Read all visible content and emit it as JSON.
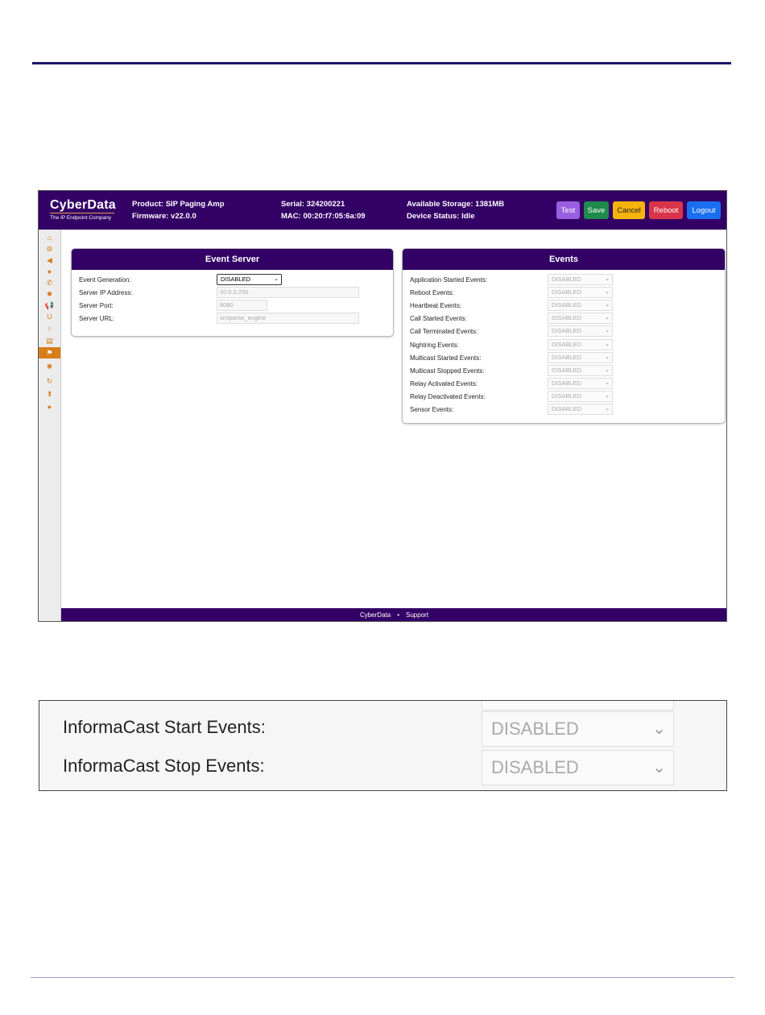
{
  "header": {
    "logo_name": "CyberData",
    "logo_tagline": "The IP Endpoint Company",
    "product": "Product: SIP Paging Amp",
    "firmware": "Firmware: v22.0.0",
    "serial": "Serial: 324200221",
    "mac": "MAC: 00:20:f7:05:6a:09",
    "storage": "Available Storage: 1381MB",
    "status": "Device Status: Idle",
    "buttons": {
      "test": "Test",
      "save": "Save",
      "cancel": "Cancel",
      "reboot": "Reboot",
      "logout": "Logout"
    }
  },
  "sidebar": {
    "icons": [
      "home-icon",
      "gears-icon",
      "speaker-icon",
      "globe-icon",
      "phone-icon",
      "gear-icon",
      "megaphone-icon",
      "magnet-icon",
      "bulb-icon",
      "document-icon",
      "flag-icon",
      "sun-icon",
      "sync-icon",
      "upload-icon",
      "user-icon"
    ],
    "glyphs": [
      "⌂",
      "⚙",
      "◀",
      "●",
      "✆",
      "✹",
      "📢",
      "U",
      "♀",
      "▤",
      "⚑",
      "✺",
      "↻",
      "⬆",
      "●"
    ],
    "active_index": 10
  },
  "event_server": {
    "title": "Event Server",
    "generation_label": "Event Generation:",
    "generation_value": "DISABLED",
    "ip_label": "Server IP Address:",
    "ip_value": "10.0.0.250",
    "port_label": "Server Port:",
    "port_value": "8080",
    "url_label": "Server URL:",
    "url_value": "xmlparse_engine"
  },
  "events": {
    "title": "Events",
    "rows": [
      {
        "label": "Application Started Events:",
        "value": "DISABLED"
      },
      {
        "label": "Reboot Events:",
        "value": "DISABLED"
      },
      {
        "label": "Heartbeat Events:",
        "value": "DISABLED"
      },
      {
        "label": "Call Started Events:",
        "value": "DISABLED"
      },
      {
        "label": "Call Terminated Events:",
        "value": "DISABLED"
      },
      {
        "label": "Nightring Events:",
        "value": "DISABLED"
      },
      {
        "label": "Multicast Started Events:",
        "value": "DISABLED"
      },
      {
        "label": "Multicast Stopped Events:",
        "value": "DISABLED"
      },
      {
        "label": "Relay Activated Events:",
        "value": "DISABLED"
      },
      {
        "label": "Relay Deactivated Events:",
        "value": "DISABLED"
      },
      {
        "label": "Sensor Events:",
        "value": "DISABLED"
      }
    ]
  },
  "footer": {
    "link1": "CyberData",
    "separator": "•",
    "link2": "Support"
  },
  "inset": {
    "rows": [
      {
        "label": "InformaCast Start Events:",
        "value": "DISABLED"
      },
      {
        "label": "InformaCast Stop Events:",
        "value": "DISABLED"
      }
    ]
  },
  "colors": {
    "brand": "#330066",
    "accent": "#d77d1a"
  }
}
